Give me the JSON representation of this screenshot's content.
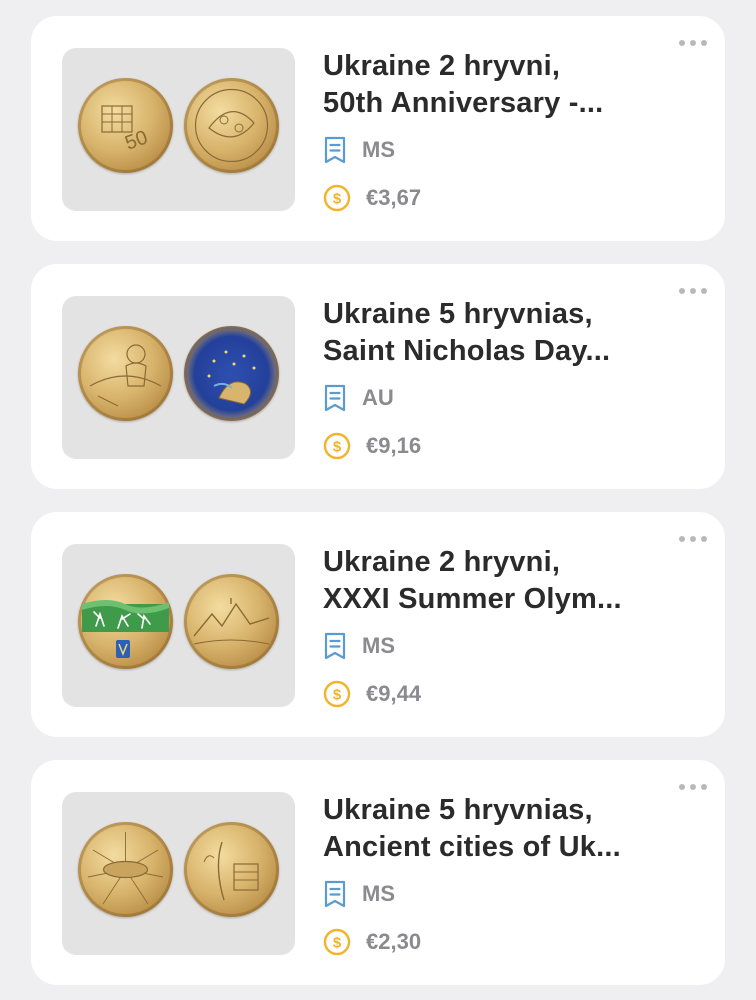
{
  "items": [
    {
      "title_line1": "Ukraine 2 hryvni,",
      "title_line2": "50th Anniversary -...",
      "grade": "MS",
      "price": "€3,67"
    },
    {
      "title_line1": "Ukraine 5 hryvnias,",
      "title_line2": "Saint Nicholas Day...",
      "grade": "AU",
      "price": "€9,16"
    },
    {
      "title_line1": "Ukraine 2 hryvni,",
      "title_line2": "XXXI Summer Olym...",
      "grade": "MS",
      "price": "€9,44"
    },
    {
      "title_line1": "Ukraine 5 hryvnias,",
      "title_line2": "Ancient cities of Uk...",
      "grade": "MS",
      "price": "€2,30"
    }
  ],
  "colors": {
    "grade_icon": "#5b9bd5",
    "price_icon": "#f0b429",
    "title_text": "#2b2b2b",
    "meta_text": "#8a8a8f"
  },
  "icons": {
    "grade": "document-icon",
    "price": "dollar-coin-icon",
    "more": "ellipsis-icon"
  }
}
